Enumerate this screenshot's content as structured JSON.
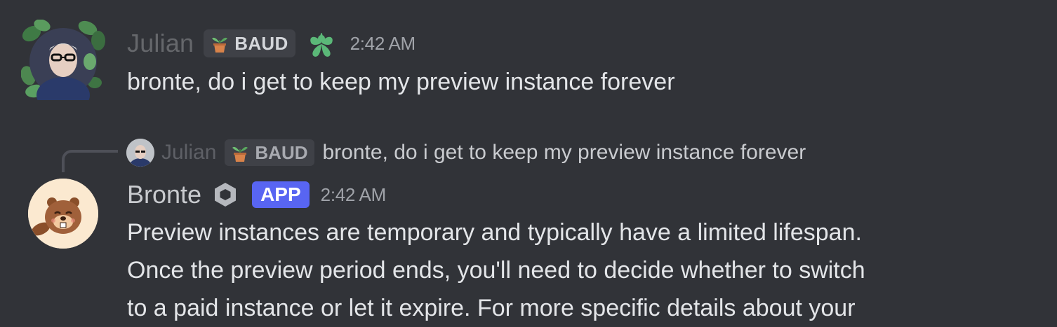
{
  "colors": {
    "background": "#313338",
    "app_badge": "#5865f2",
    "role_tag_bg": "#3f4147",
    "heart_green": "#5bb878"
  },
  "messages": [
    {
      "author": "Julian",
      "role_tag": "BAUD",
      "role_icon": "potted-plant-icon",
      "extra_icon": "green-heart-icon",
      "timestamp": "2:42 AM",
      "text": "bronte, do i get to keep my preview instance forever"
    },
    {
      "reply_to": {
        "author": "Julian",
        "role_tag": "BAUD",
        "text": "bronte, do i get to keep my preview instance forever"
      },
      "author": "Bronte",
      "author_icon": "hexagon-icon",
      "badge": "APP",
      "timestamp": "2:42 AM",
      "lines": [
        "Preview instances are temporary and typically have a limited lifespan.",
        "Once the preview period ends, you'll need to decide whether to switch",
        "to a paid instance or let it expire. For more specific details about your"
      ]
    }
  ]
}
